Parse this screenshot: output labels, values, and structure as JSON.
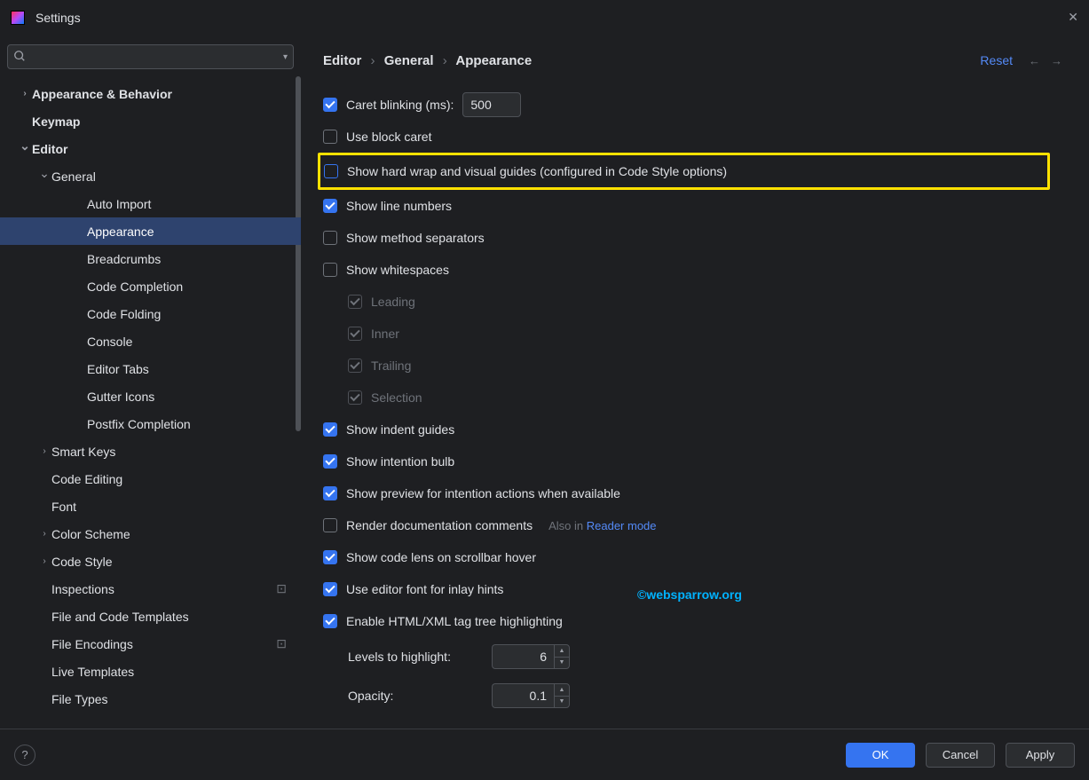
{
  "window": {
    "title": "Settings"
  },
  "search": {
    "placeholder": ""
  },
  "tree": {
    "items": [
      {
        "label": "Appearance & Behavior",
        "depth": 0,
        "arrow": "right",
        "bold": true
      },
      {
        "label": "Keymap",
        "depth": 0,
        "arrow": "",
        "bold": true
      },
      {
        "label": "Editor",
        "depth": 0,
        "arrow": "down",
        "bold": true
      },
      {
        "label": "General",
        "depth": 1,
        "arrow": "down",
        "bold": false
      },
      {
        "label": "Auto Import",
        "depth": 2,
        "arrow": "",
        "bold": false
      },
      {
        "label": "Appearance",
        "depth": 2,
        "arrow": "",
        "bold": false,
        "selected": true
      },
      {
        "label": "Breadcrumbs",
        "depth": 2,
        "arrow": "",
        "bold": false
      },
      {
        "label": "Code Completion",
        "depth": 2,
        "arrow": "",
        "bold": false
      },
      {
        "label": "Code Folding",
        "depth": 2,
        "arrow": "",
        "bold": false
      },
      {
        "label": "Console",
        "depth": 2,
        "arrow": "",
        "bold": false
      },
      {
        "label": "Editor Tabs",
        "depth": 2,
        "arrow": "",
        "bold": false
      },
      {
        "label": "Gutter Icons",
        "depth": 2,
        "arrow": "",
        "bold": false
      },
      {
        "label": "Postfix Completion",
        "depth": 2,
        "arrow": "",
        "bold": false
      },
      {
        "label": "Smart Keys",
        "depth": 1,
        "arrow": "right",
        "bold": false
      },
      {
        "label": "Code Editing",
        "depth": 1,
        "arrow": "",
        "bold": false
      },
      {
        "label": "Font",
        "depth": 1,
        "arrow": "",
        "bold": false
      },
      {
        "label": "Color Scheme",
        "depth": 1,
        "arrow": "right",
        "bold": false
      },
      {
        "label": "Code Style",
        "depth": 1,
        "arrow": "right",
        "bold": false
      },
      {
        "label": "Inspections",
        "depth": 1,
        "arrow": "",
        "bold": false,
        "badge": "⊡"
      },
      {
        "label": "File and Code Templates",
        "depth": 1,
        "arrow": "",
        "bold": false
      },
      {
        "label": "File Encodings",
        "depth": 1,
        "arrow": "",
        "bold": false,
        "badge": "⊡"
      },
      {
        "label": "Live Templates",
        "depth": 1,
        "arrow": "",
        "bold": false
      },
      {
        "label": "File Types",
        "depth": 1,
        "arrow": "",
        "bold": false
      }
    ]
  },
  "breadcrumb": {
    "part1": "Editor",
    "part2": "General",
    "part3": "Appearance"
  },
  "header": {
    "reset": "Reset"
  },
  "options": {
    "caret_blinking_label": "Caret blinking (ms):",
    "caret_blinking_value": "500",
    "use_block_caret": "Use block caret",
    "show_hard_wrap": "Show hard wrap and visual guides (configured in Code Style options)",
    "show_line_numbers": "Show line numbers",
    "show_method_separators": "Show method separators",
    "show_whitespaces": "Show whitespaces",
    "ws_leading": "Leading",
    "ws_inner": "Inner",
    "ws_trailing": "Trailing",
    "ws_selection": "Selection",
    "show_indent_guides": "Show indent guides",
    "show_intention_bulb": "Show intention bulb",
    "show_preview_intention": "Show preview for intention actions when available",
    "render_doc_comments": "Render documentation comments",
    "also_in_text": "Also in ",
    "also_in_link": "Reader mode",
    "show_code_lens": "Show code lens on scrollbar hover",
    "use_editor_font_inlay": "Use editor font for inlay hints",
    "enable_html_xml_tag": "Enable HTML/XML tag tree highlighting",
    "levels_label": "Levels to highlight:",
    "levels_value": "6",
    "opacity_label": "Opacity:",
    "opacity_value": "0.1"
  },
  "watermark": "©websparrow.org",
  "footer": {
    "ok": "OK",
    "cancel": "Cancel",
    "apply": "Apply"
  }
}
